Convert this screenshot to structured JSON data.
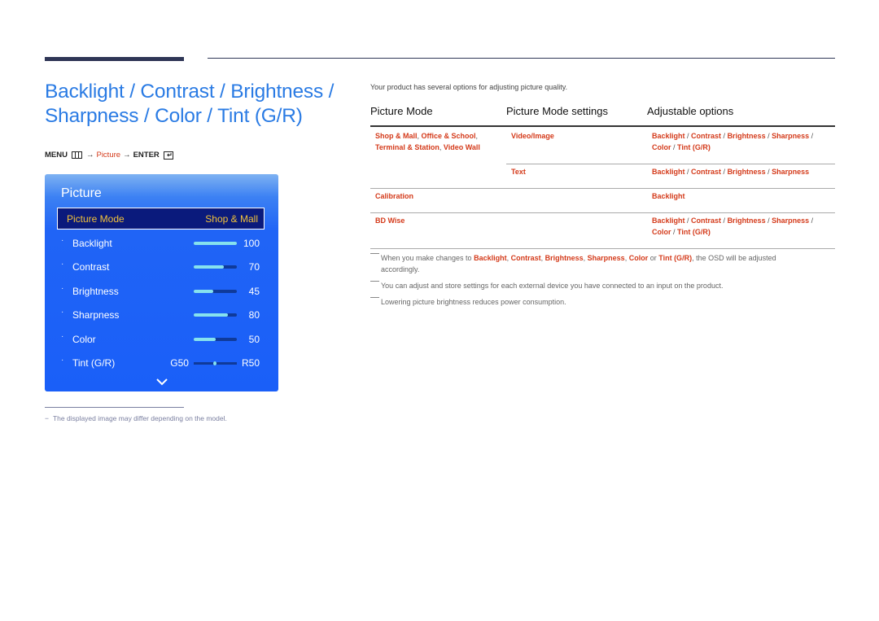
{
  "page": {
    "title": "Backlight / Contrast / Brightness / Sharpness / Color / Tint (G/R)",
    "title_line1": "Backlight / Contrast / Brightness /",
    "title_line2": "Sharpness / Color / Tint (G/R)",
    "menu_path": {
      "menu_label": "MENU",
      "menu_icon": "menu-icon",
      "arrow1": "→",
      "picture_label": "Picture",
      "arrow2": "→",
      "enter_label": "ENTER",
      "enter_icon": "enter-icon",
      "enter_glyph": "↵"
    }
  },
  "osd": {
    "title": "Picture",
    "selected_item": {
      "label": "Picture Mode",
      "value": "Shop & Mall"
    },
    "items": [
      {
        "label": "Backlight",
        "value": "100",
        "level": 100,
        "max": 100
      },
      {
        "label": "Contrast",
        "value": "70",
        "level": 70,
        "max": 100
      },
      {
        "label": "Brightness",
        "value": "45",
        "level": 45,
        "max": 100
      },
      {
        "label": "Sharpness",
        "value": "80",
        "level": 80,
        "max": 100
      },
      {
        "label": "Color",
        "value": "50",
        "level": 50,
        "max": 100
      }
    ],
    "tint": {
      "label": "Tint (G/R)",
      "left_value": "G50",
      "right_value": "R50",
      "position_fraction": 0.5
    },
    "bullet": "·",
    "more_icon": "chevron-down-icon",
    "colors": {
      "selected_text": "#f2c23a",
      "selected_bg": "#0a1a7c",
      "slider_fill": "#86e2ee",
      "slider_track": "#0f3a9a",
      "panel": "#1a5ff8"
    }
  },
  "footnote": {
    "dash": "−",
    "text": "The displayed image may differ depending on the model."
  },
  "intro_text": "Your product has several options for adjusting picture quality.",
  "table": {
    "headers": [
      "Picture Mode",
      "Picture Mode settings",
      "Adjustable options"
    ],
    "rows": [
      {
        "mode_parts": [
          "Shop & Mall",
          ", ",
          "Office & School",
          ","
        ],
        "mode_parts_line2": [
          "Terminal & Station",
          ", ",
          "Video Wall"
        ],
        "setting": "Video/Image",
        "options_line1": [
          "Backlight",
          " / ",
          "Contrast",
          " / ",
          "Brightness",
          " / ",
          "Sharpness",
          " /"
        ],
        "options_line2": [
          "Color",
          " / ",
          "Tint (G/R)"
        ]
      },
      {
        "mode_parts": [],
        "setting": "Text",
        "options_line1": [
          "Backlight",
          " / ",
          "Contrast",
          " / ",
          "Brightness",
          " / ",
          "Sharpness"
        ]
      },
      {
        "mode_parts": [
          "Calibration"
        ],
        "setting": "",
        "options_line1": [
          "Backlight"
        ]
      },
      {
        "mode_parts": [
          "BD Wise"
        ],
        "setting": "",
        "options_line1": [
          "Backlight",
          " / ",
          "Contrast",
          " / ",
          "Brightness",
          " / ",
          "Sharpness",
          " /"
        ],
        "options_line2": [
          "Color",
          " / ",
          "Tint (G/R)"
        ]
      }
    ],
    "accent_color": "#d43a1a"
  },
  "notes": [
    {
      "parts": [
        {
          "t": "When you make changes to ",
          "b": false
        },
        {
          "t": "Backlight",
          "b": true
        },
        {
          "t": ", ",
          "b": false
        },
        {
          "t": "Contrast",
          "b": true
        },
        {
          "t": ", ",
          "b": false
        },
        {
          "t": "Brightness",
          "b": true
        },
        {
          "t": ", ",
          "b": false
        },
        {
          "t": "Sharpness",
          "b": true
        },
        {
          "t": ", ",
          "b": false
        },
        {
          "t": "Color",
          "b": true
        },
        {
          "t": " or ",
          "b": false
        },
        {
          "t": "Tint (G/R)",
          "b": true
        },
        {
          "t": ", the OSD will be adjusted",
          "b": false
        }
      ],
      "continuation": "accordingly."
    },
    {
      "text": "You can adjust and store settings for each external device you have connected to an input on the product."
    },
    {
      "text": "Lowering picture brightness reduces power consumption."
    }
  ]
}
